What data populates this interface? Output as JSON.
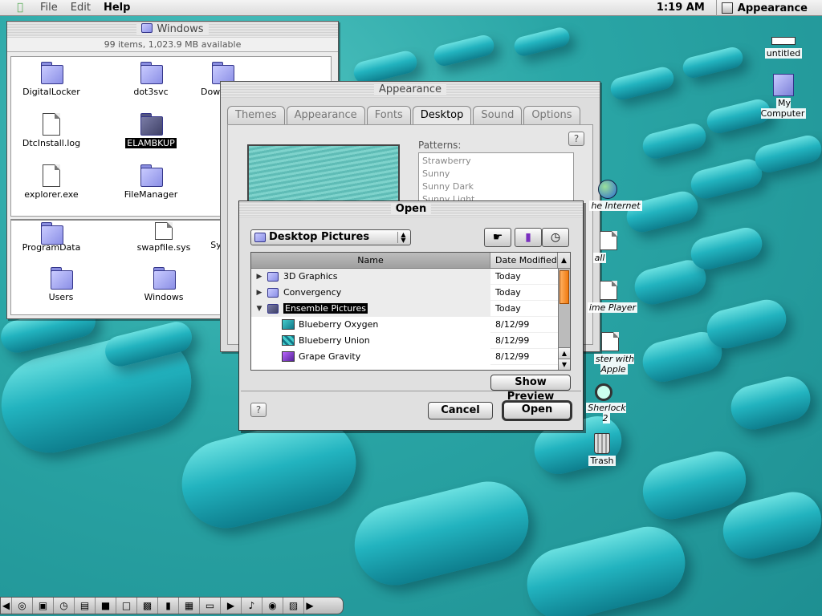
{
  "menubar": {
    "apple_label": "",
    "menus": [
      "File",
      "Edit",
      "Help"
    ],
    "clock": "1:19 AM",
    "app_name": "Appearance"
  },
  "finder": {
    "title": "Windows",
    "info": "99 items, 1,023.9 MB available",
    "icons": [
      {
        "label": "DigitalLocker",
        "kind": "folder"
      },
      {
        "label": "dot3svc",
        "kind": "folder"
      },
      {
        "label": "Dowr",
        "kind": "folder"
      },
      {
        "label": "DtcInstall.log",
        "kind": "doc"
      },
      {
        "label": "ELAMBKUP",
        "kind": "folder-dark"
      },
      {
        "label": "explorer.exe",
        "kind": "doc"
      },
      {
        "label": "FileManager",
        "kind": "folder"
      },
      {
        "label": "ProgramData",
        "kind": "folder"
      },
      {
        "label": "swapfile.sys",
        "kind": "doc"
      },
      {
        "label": "Sy",
        "kind": "doc"
      },
      {
        "label": "Users",
        "kind": "folder"
      },
      {
        "label": "Windows",
        "kind": "folder-pattern"
      }
    ]
  },
  "appearance": {
    "title": "Appearance",
    "tabs": [
      "Themes",
      "Appearance",
      "Fonts",
      "Desktop",
      "Sound",
      "Options"
    ],
    "active_tab": "Desktop",
    "help": "?",
    "patterns_label": "Patterns:",
    "patterns": [
      "Strawberry",
      "Sunny",
      "Sunny Dark",
      "Sunny Light"
    ]
  },
  "open_dialog": {
    "title": "Open",
    "location": "Desktop Pictures",
    "columns": {
      "name": "Name",
      "date": "Date Modified"
    },
    "rows": [
      {
        "name": "3D Graphics",
        "date": "Today",
        "kind": "folder",
        "expanded": false
      },
      {
        "name": "Convergency",
        "date": "Today",
        "kind": "folder",
        "expanded": false
      },
      {
        "name": "Ensemble Pictures",
        "date": "Today",
        "kind": "folder-open",
        "expanded": true,
        "selected": true
      },
      {
        "name": "Blueberry Oxygen",
        "date": "8/12/99",
        "kind": "picture"
      },
      {
        "name": "Blueberry Union",
        "date": "8/12/99",
        "kind": "picture"
      },
      {
        "name": "Grape Gravity",
        "date": "8/12/99",
        "kind": "picture-purple"
      }
    ],
    "show_preview": "Show Preview",
    "cancel": "Cancel",
    "open": "Open",
    "help": "?"
  },
  "desktop_icons": {
    "untitled": "untitled",
    "my_computer": "My Computer",
    "internet": "he Internet",
    "mail": "all",
    "media": "ime Player",
    "register": "ster with Apple",
    "sherlock": "Sherlock 2",
    "trash": "Trash"
  },
  "colors": {
    "desktop": "#2aa6a6",
    "pill": "#22b3bf",
    "scroll_thumb": "#f07a10"
  }
}
